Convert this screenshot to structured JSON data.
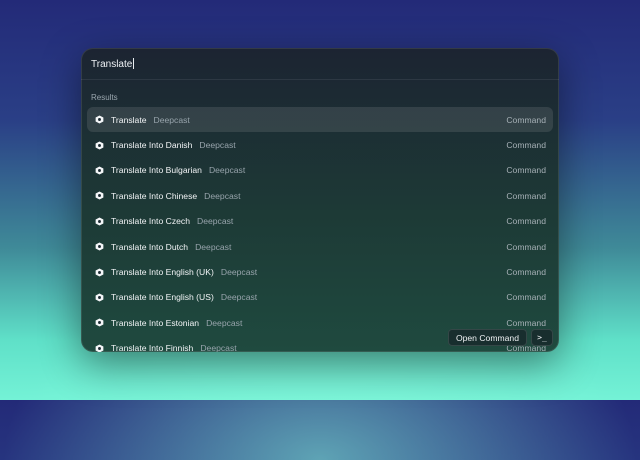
{
  "search": {
    "value": "Translate"
  },
  "section_label": "Results",
  "results": [
    {
      "title": "Translate",
      "subtitle": "Deepcast",
      "type": "Command",
      "icon": "deepcast-icon",
      "selected": true
    },
    {
      "title": "Translate Into Danish",
      "subtitle": "Deepcast",
      "type": "Command",
      "icon": "deepcast-icon"
    },
    {
      "title": "Translate Into Bulgarian",
      "subtitle": "Deepcast",
      "type": "Command",
      "icon": "deepcast-icon"
    },
    {
      "title": "Translate Into Chinese",
      "subtitle": "Deepcast",
      "type": "Command",
      "icon": "deepcast-icon"
    },
    {
      "title": "Translate Into Czech",
      "subtitle": "Deepcast",
      "type": "Command",
      "icon": "deepcast-icon"
    },
    {
      "title": "Translate Into Dutch",
      "subtitle": "Deepcast",
      "type": "Command",
      "icon": "deepcast-icon"
    },
    {
      "title": "Translate Into English (UK)",
      "subtitle": "Deepcast",
      "type": "Command",
      "icon": "deepcast-icon"
    },
    {
      "title": "Translate Into English (US)",
      "subtitle": "Deepcast",
      "type": "Command",
      "icon": "deepcast-icon"
    },
    {
      "title": "Translate Into Estonian",
      "subtitle": "Deepcast",
      "type": "Command",
      "icon": "deepcast-icon"
    },
    {
      "title": "Translate Into Finnish",
      "subtitle": "Deepcast",
      "type": "Command",
      "icon": "deepcast-icon"
    }
  ],
  "actions": {
    "open_command_label": "Open Command",
    "terminal_label": ">_"
  },
  "colors": {
    "accent_selected_row": "#3a4450",
    "text_primary": "#f2f4f6",
    "text_secondary": "#98a4ac"
  }
}
